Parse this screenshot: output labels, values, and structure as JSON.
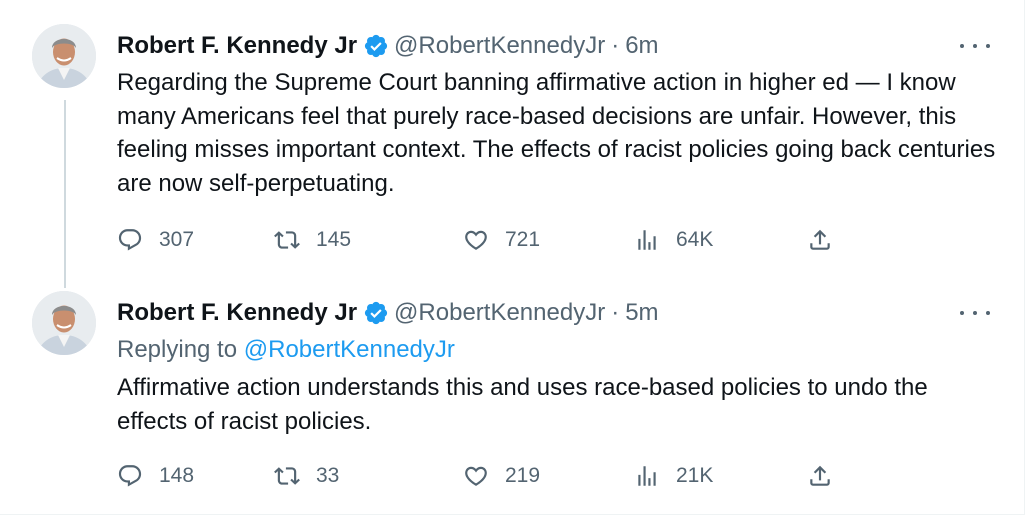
{
  "tweets": [
    {
      "author_name": "Robert F. Kennedy Jr",
      "handle": "@RobertKennedyJr",
      "separator": "·",
      "time": "6m",
      "replying_prefix": "",
      "replying_to": "",
      "text": "Regarding the Supreme Court banning affirmative action in higher ed — I know many Americans feel that purely race-based decisions are unfair. However, this feeling misses important context. The effects of racist policies going back centuries are now self-perpetuating.",
      "replies": "307",
      "retweets": "145",
      "likes": "721",
      "views": "64K"
    },
    {
      "author_name": "Robert F. Kennedy Jr",
      "handle": "@RobertKennedyJr",
      "separator": "·",
      "time": "5m",
      "replying_prefix": "Replying to",
      "replying_to": "@RobertKennedyJr",
      "text": "Affirmative action understands this and uses race-based policies to undo the effects of racist policies.",
      "replies": "148",
      "retweets": "33",
      "likes": "219",
      "views": "21K"
    }
  ],
  "colors": {
    "text_primary": "#0f1419",
    "text_secondary": "#536471",
    "accent": "#1d9bf0",
    "thread_line": "#cfd9de"
  },
  "icons": {
    "verified": "verified-badge-icon",
    "more": "more-icon",
    "reply": "reply-icon",
    "retweet": "retweet-icon",
    "like": "heart-icon",
    "views": "views-icon",
    "share": "share-icon"
  }
}
